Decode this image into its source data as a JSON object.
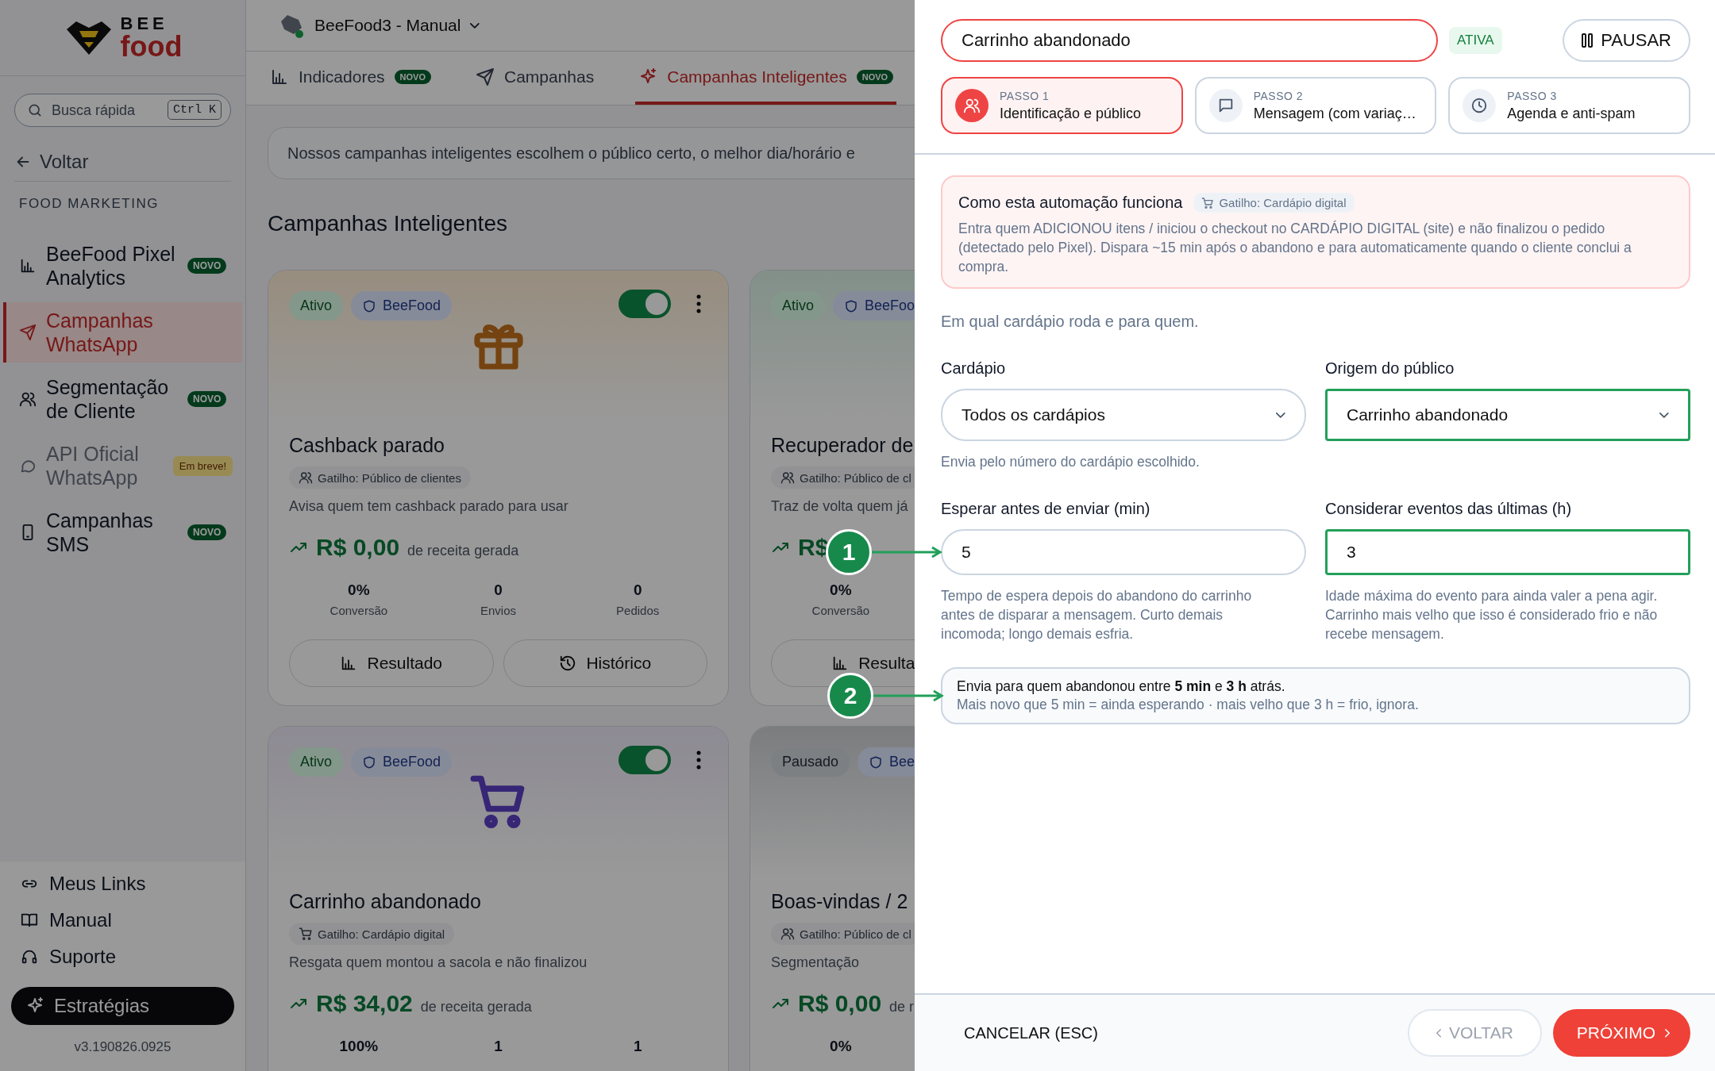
{
  "sidebar": {
    "logo": {
      "line1": "BEE",
      "line2": "food"
    },
    "search": {
      "placeholder": "Busca rápida",
      "shortcut": "Ctrl K"
    },
    "back": "Voltar",
    "section": "FOOD MARKETING",
    "items": [
      {
        "label": "BeeFood Pixel Analytics",
        "selected": false,
        "disabled": false,
        "badge": {
          "text": "NOVO",
          "kind": "new"
        }
      },
      {
        "label": "Campanhas WhatsApp",
        "selected": true,
        "disabled": false
      },
      {
        "label": "Segmentação de Cliente",
        "selected": false,
        "disabled": false,
        "badge": {
          "text": "NOVO",
          "kind": "new"
        }
      },
      {
        "label": "API Oficial WhatsApp",
        "selected": false,
        "disabled": true,
        "badge": {
          "text": "Em breve!",
          "kind": "soon"
        }
      },
      {
        "label": "Campanhas SMS",
        "selected": false,
        "disabled": false,
        "badge": {
          "text": "NOVO",
          "kind": "new"
        }
      }
    ],
    "footer_links": [
      "Meus Links",
      "Manual",
      "Suporte"
    ],
    "cta": "Estratégias",
    "version": "v3.190826.0925"
  },
  "main": {
    "workspace": "BeeFood3 - Manual",
    "tabs": [
      {
        "label": "Indicadores",
        "badge": "NOVO",
        "selected": false
      },
      {
        "label": "Campanhas",
        "selected": false
      },
      {
        "label": "Campanhas Inteligentes",
        "badge": "NOVO",
        "selected": true
      }
    ],
    "banner": "Nossos campanhas inteligentes escolhem o público certo, o melhor dia/horário e",
    "heading": "Campanhas Inteligentes",
    "cards": [
      {
        "kind": "cashback",
        "status": "Ativo",
        "active": true,
        "owner": "BeeFood",
        "enabled": true,
        "title": "Cashback parado",
        "trigger": "Gatilho: Público de clientes",
        "description": "Avisa quem tem cashback parado para usar",
        "revenue": "R$ 0,00",
        "revenue_label": "de receita gerada",
        "stats": [
          {
            "value": "0%",
            "label": "Conversão"
          },
          {
            "value": "0",
            "label": "Envios"
          },
          {
            "value": "0",
            "label": "Pedidos"
          }
        ],
        "buttons": [
          "Resultado",
          "Histórico"
        ]
      },
      {
        "kind": "recovery",
        "status": "Ativo",
        "active": true,
        "owner": "BeeFoo",
        "title": "Recuperador de",
        "trigger": "Gatilho: Público de cl",
        "description": "Traz de volta quem já",
        "revenue": "R$",
        "stats": [
          {
            "value": "0%",
            "label": "Conversão"
          }
        ],
        "buttons": [
          "Resulta"
        ]
      },
      {
        "kind": "cart",
        "status": "Ativo",
        "active": true,
        "owner": "BeeFood",
        "enabled": true,
        "title": "Carrinho abandonado",
        "trigger": "Gatilho: Cardápio digital",
        "description": "Resgata quem montou a sacola e não finalizou",
        "revenue": "R$ 34,02",
        "revenue_label": "de receita gerada",
        "stats": [
          {
            "value": "100%"
          },
          {
            "value": "1"
          },
          {
            "value": "1"
          }
        ]
      },
      {
        "kind": "welcome",
        "status": "Pausado",
        "active": false,
        "owner": "Bee",
        "title": "Boas-vindas / 2",
        "trigger": "Gatilho: Público de cl",
        "description": "Segmentação",
        "revenue": "R$ 0,00",
        "revenue_label": "de r",
        "stats": [
          {
            "value": "0%"
          }
        ]
      }
    ]
  },
  "drawer": {
    "name": "Carrinho abandonado",
    "status": "ATIVA",
    "pause": "PAUSAR",
    "steps": [
      {
        "label": "PASSO 1",
        "title": "Identificação e público",
        "selected": true
      },
      {
        "label": "PASSO 2",
        "title": "Mensagem (com variaç…",
        "selected": false
      },
      {
        "label": "PASSO 3",
        "title": "Agenda e anti-spam",
        "selected": false
      }
    ],
    "info": {
      "title": "Como esta automação funciona",
      "trigger": "Gatilho: Cardápio digital",
      "text": "Entra quem ADICIONOU itens / iniciou o checkout no CARDÁPIO DIGITAL (site) e não finalizou o pedido (detectado pelo Pixel). Dispara ~15 min após o abandono e para automaticamente quando o cliente conclui a compra."
    },
    "intro": "Em qual cardápio roda e para quem.",
    "fields": [
      {
        "kind": "select",
        "label": "Cardápio",
        "value": "Todos os cardápios",
        "help": "Envia pelo número do cardápio escolhido.",
        "highlighted": false
      },
      {
        "kind": "select",
        "label": "Origem do público",
        "value": "Carrinho abandonado",
        "highlighted": true
      },
      {
        "kind": "input",
        "label": "Esperar antes de enviar (min)",
        "value": "5",
        "help": "Tempo de espera depois do abandono do carrinho antes de disparar a mensagem. Curto demais incomoda; longo demais esfria.",
        "highlighted": false,
        "marker": "1"
      },
      {
        "kind": "input",
        "label": "Considerar eventos das últimas (h)",
        "value": "3",
        "help": "Idade máxima do evento para ainda valer a pena agir. Carrinho mais velho que isso é considerado frio e não recebe mensagem.",
        "highlighted": true
      }
    ],
    "summary": {
      "line1": "Envia para quem abandonou entre **5 min** e **3 h** atrás.",
      "line2": "Mais novo que 5 min = ainda esperando · mais velho que 3 h = frio, ignora.",
      "marker": "2"
    },
    "cancel": "CANCELAR (ESC)",
    "back": "VOLTAR",
    "next": "PRÓXIMO"
  }
}
